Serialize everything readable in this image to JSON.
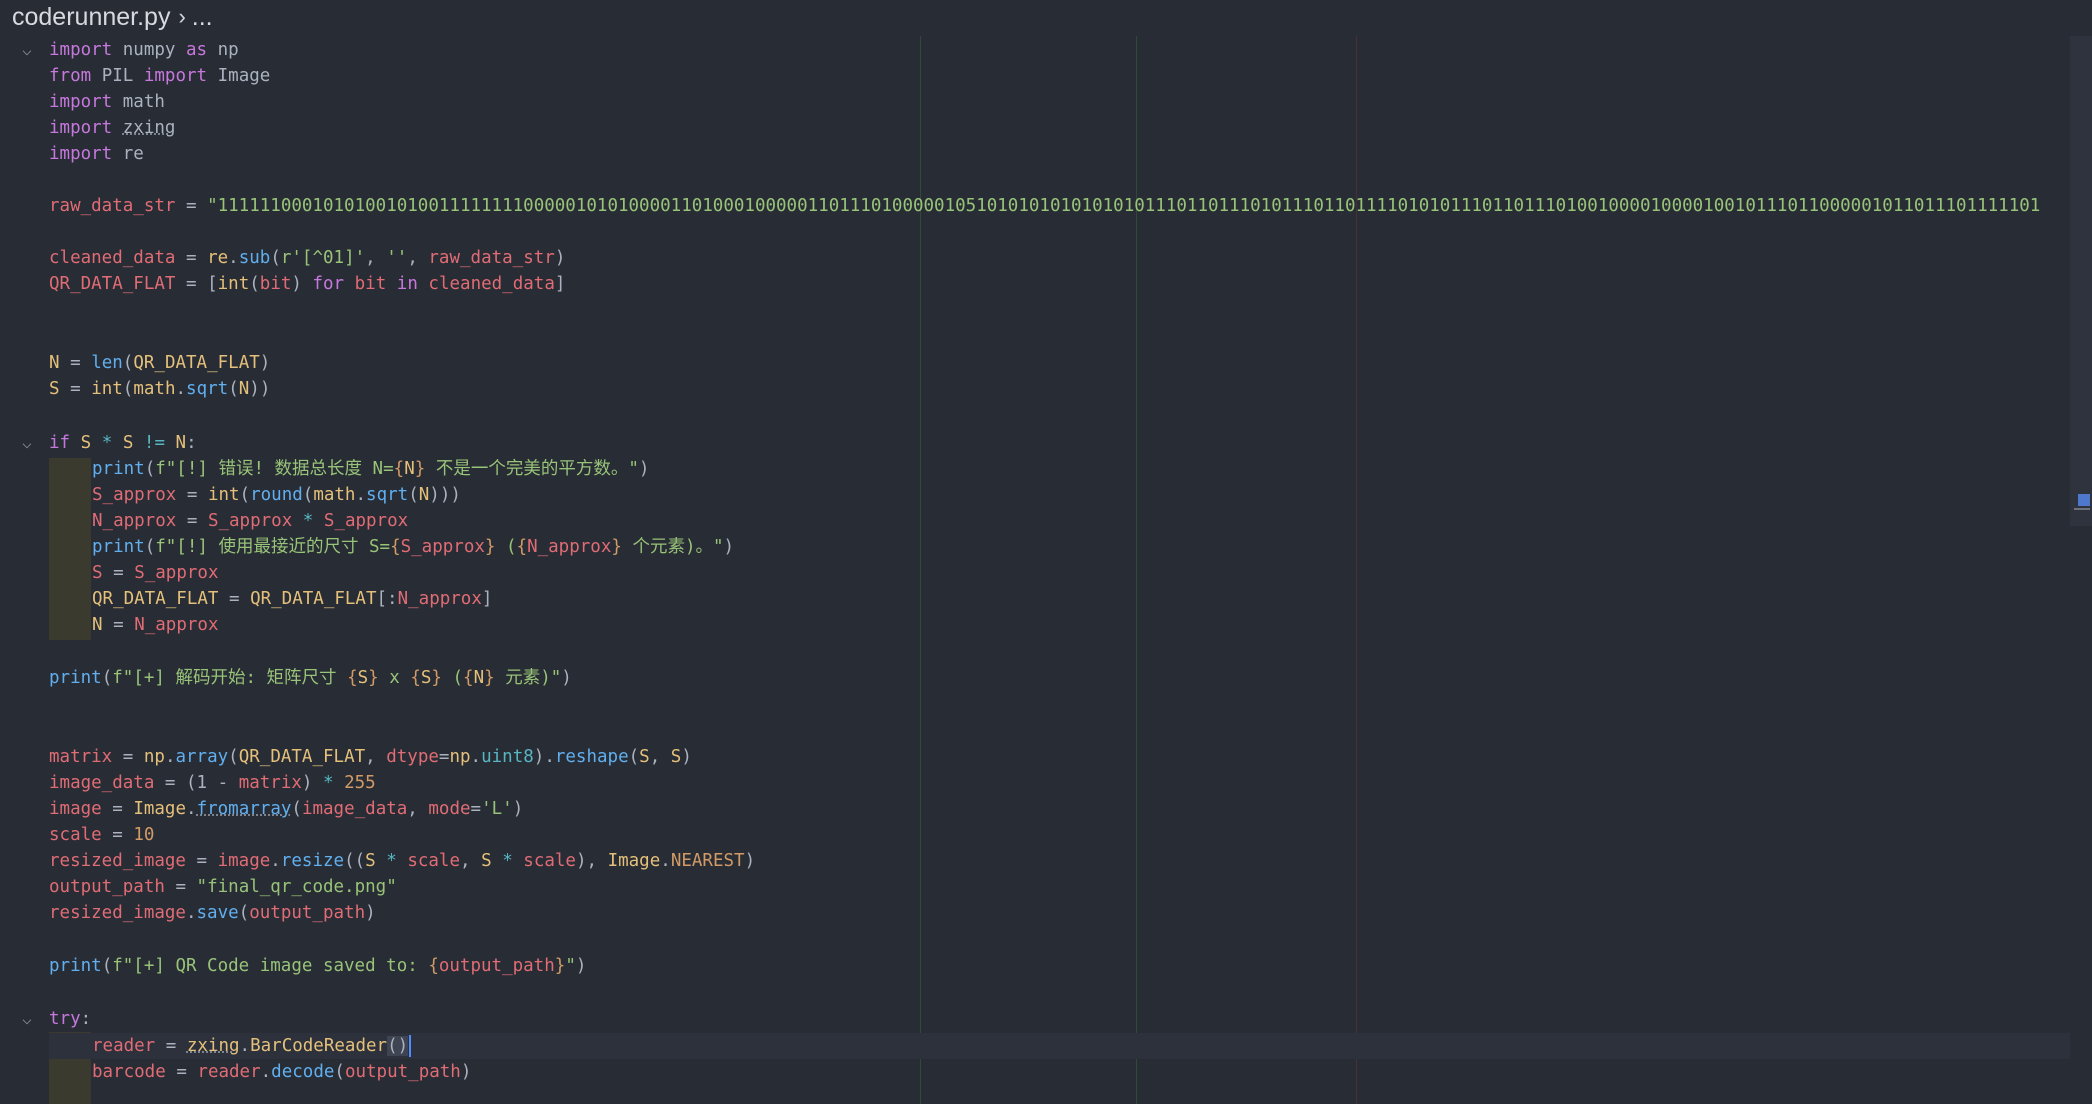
{
  "breadcrumb": {
    "file": "coderunner.py",
    "separator": "›",
    "more": "..."
  },
  "code": {
    "l1": [
      "import",
      "numpy",
      "as",
      "np"
    ],
    "l2": [
      "from",
      "PIL",
      "import",
      "Image"
    ],
    "l3": [
      "import",
      "math"
    ],
    "l4": [
      "import",
      "zxing"
    ],
    "l5": [
      "import",
      "re"
    ],
    "l7": [
      "raw_data_str",
      "=",
      "\"11111100010101001010011111111000001010100001101000100000110111010000010510101010101010101110110111010111011011110101011101101110100100001000010010111011000001011011101111101"
    ],
    "l9": [
      "cleaned_data",
      "=",
      "re",
      ".",
      "sub",
      "(",
      "r'[^01]'",
      ", ",
      "''",
      ", ",
      "raw_data_str",
      ")"
    ],
    "l10": [
      "QR_DATA_FLAT",
      "=",
      "[",
      "int",
      "(",
      "bit",
      ")",
      "for",
      "bit",
      "in",
      "cleaned_data",
      "]"
    ],
    "l13": [
      "N",
      "=",
      "len",
      "(",
      "QR_DATA_FLAT",
      ")"
    ],
    "l14": [
      "S",
      "=",
      "int",
      "(",
      "math",
      ".",
      "sqrt",
      "(",
      "N",
      "))"
    ],
    "l16": [
      "if",
      "S",
      "*",
      "S",
      "!=",
      "N",
      ":"
    ],
    "l17": [
      "print",
      "(",
      "f\"[!] 错误! 数据总长度 N=",
      "{",
      "N",
      "}",
      " 不是一个完美的平方数。\"",
      ")"
    ],
    "l18": [
      "S_approx",
      "=",
      "int",
      "(",
      "round",
      "(",
      "math",
      ".",
      "sqrt",
      "(",
      "N",
      ")))"
    ],
    "l19": [
      "N_approx",
      "=",
      "S_approx",
      "*",
      "S_approx"
    ],
    "l20": [
      "print",
      "(",
      "f\"[!] 使用最接近的尺寸 S=",
      "{",
      "S_approx",
      "}",
      " (",
      "{",
      "N_approx",
      "}",
      " 个元素)。\"",
      ")"
    ],
    "l21": [
      "S",
      "=",
      "S_approx"
    ],
    "l22": [
      "QR_DATA_FLAT",
      "=",
      "QR_DATA_FLAT",
      "[:",
      "N_approx",
      "]"
    ],
    "l23": [
      "N",
      "=",
      "N_approx"
    ],
    "l25": [
      "print",
      "(",
      "f\"[+] 解码开始: 矩阵尺寸 ",
      "{",
      "S",
      "}",
      " x ",
      "{",
      "S",
      "}",
      " (",
      "{",
      "N",
      "}",
      " 元素)\"",
      ")"
    ],
    "l28": [
      "matrix",
      "=",
      "np",
      ".",
      "array",
      "(",
      "QR_DATA_FLAT",
      ", ",
      "dtype",
      "=",
      "np",
      ".",
      "uint8",
      ").",
      "reshape",
      "(",
      "S",
      ", ",
      "S",
      ")"
    ],
    "l29": [
      "image_data",
      "=",
      "(1 - ",
      "matrix",
      ")",
      "*",
      "255"
    ],
    "l30": [
      "image",
      "=",
      "Image",
      ".",
      "fromarray",
      "(",
      "image_data",
      ", ",
      "mode",
      "=",
      "'L'",
      ")"
    ],
    "l31": [
      "scale",
      "=",
      "10"
    ],
    "l32": [
      "resized_image",
      "=",
      "image",
      ".",
      "resize",
      "((",
      "S",
      "*",
      "scale",
      ", ",
      "S",
      "*",
      "scale",
      "), ",
      "Image",
      ".",
      "NEAREST",
      ")"
    ],
    "l33": [
      "output_path",
      "=",
      "\"final_qr_code.png\""
    ],
    "l34": [
      "resized_image",
      ".",
      "save",
      "(",
      "output_path",
      ")"
    ],
    "l36": [
      "print",
      "(",
      "f\"[+] QR Code image saved to: ",
      "{",
      "output_path",
      "}",
      "\"",
      ")"
    ],
    "l38": [
      "try",
      ":"
    ],
    "l39": [
      "reader",
      "=",
      "zxing",
      ".",
      "BarCodeReader",
      "()"
    ],
    "l40": [
      "barcode",
      "=",
      "reader",
      ".",
      "decode",
      "(",
      "output_path",
      ")"
    ]
  },
  "colors": {
    "background": "#282c34",
    "keyword": "#c678dd",
    "variable": "#e06c75",
    "function": "#61afef",
    "string": "#98c379",
    "number": "#d19a66",
    "class": "#e5c07b"
  },
  "icons": {
    "fold": "chevron-down-icon"
  }
}
